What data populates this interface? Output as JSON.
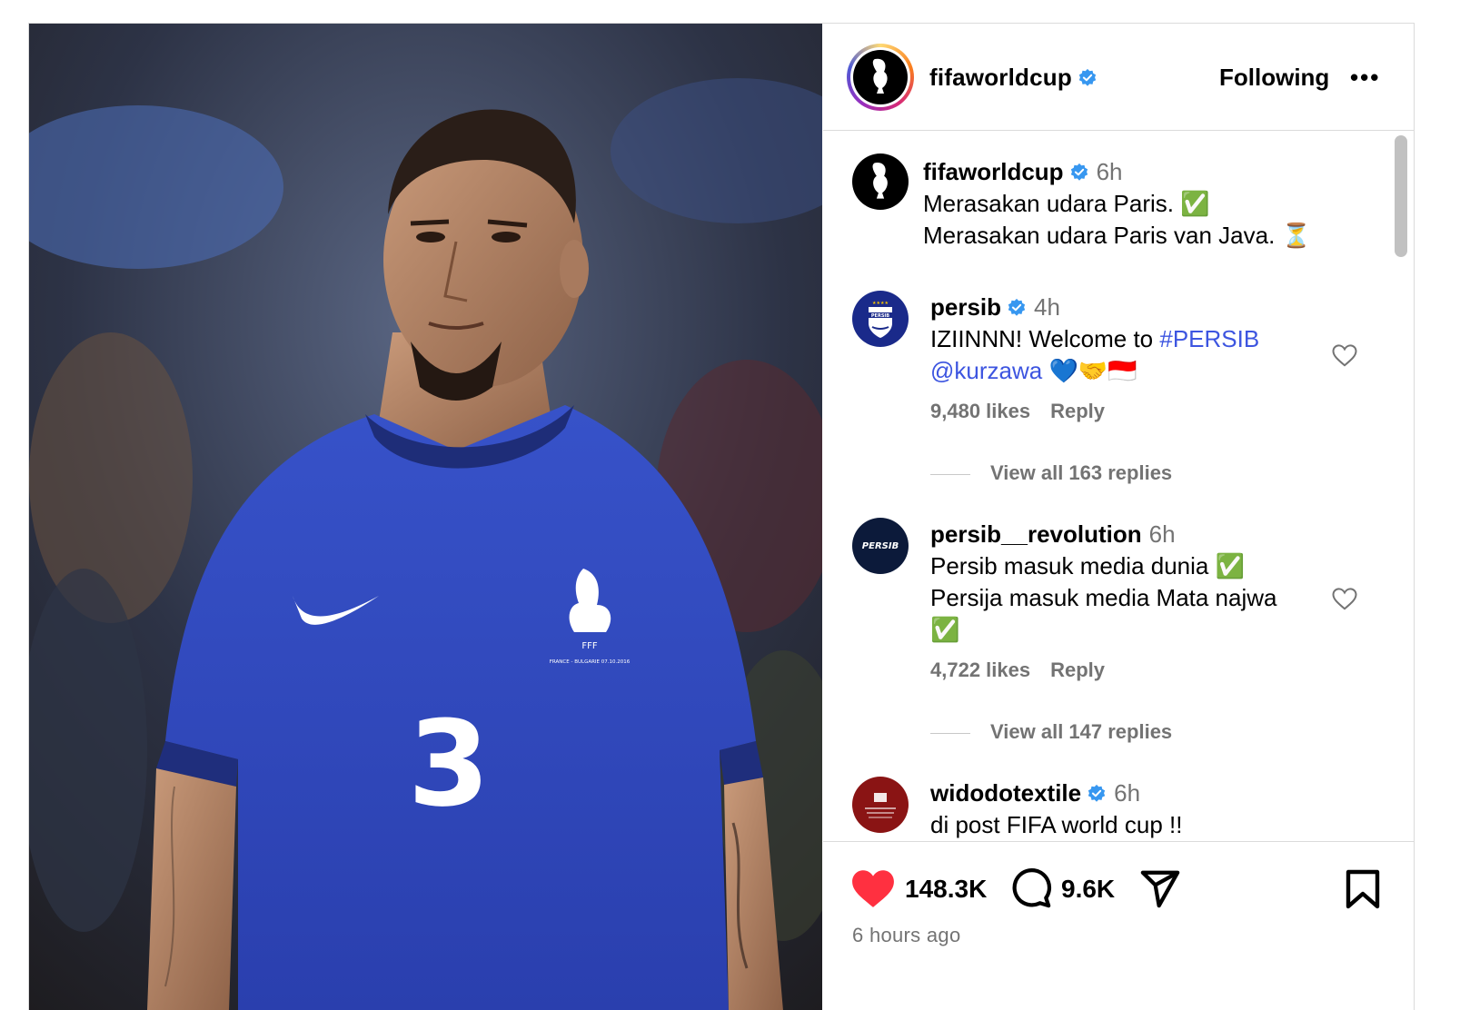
{
  "post": {
    "author": "fifaworldcup",
    "follow_state": "Following",
    "more_label": "•••",
    "avatar_text": "FIFA",
    "photo": {
      "jersey_number": "3",
      "crest_text": "FFF",
      "match_text": "FRANCE - BULGARIE 07.10.2016"
    }
  },
  "caption": {
    "username": "fifaworldcup",
    "time": "6h",
    "line1": "Merasakan udara Paris. ✅",
    "line2": "Merasakan udara Paris van Java. ⏳"
  },
  "comments": [
    {
      "username": "persib",
      "avatar_text": "PERSIB",
      "verified": true,
      "time": "4h",
      "text_plain": "IZIINNN! Welcome to ",
      "hashtag": "#PERSIB",
      "mention": "@kurzawa",
      "emoji": " 💙🤝🇮🇩",
      "likes": "9,480 likes",
      "reply": "Reply",
      "view_replies": "View all 163 replies"
    },
    {
      "username": "persib__revolution",
      "avatar_text": "PERSIB",
      "verified": false,
      "time": "6h",
      "line1": "Persib masuk media dunia ✅",
      "line2": "Persija masuk media Mata najwa",
      "line3": "✅",
      "likes": "4,722 likes",
      "reply": "Reply",
      "view_replies": "View all 147 replies"
    },
    {
      "username": "widodotextile",
      "verified": true,
      "time": "6h",
      "text": "di post FIFA world cup !!"
    }
  ],
  "actions": {
    "likes": "148.3K",
    "comments": "9.6K",
    "posted": "6 hours ago"
  },
  "colors": {
    "verified": "#3797f0",
    "like_red": "#ff3040",
    "link": "#3d55e0",
    "muted": "#737373"
  }
}
